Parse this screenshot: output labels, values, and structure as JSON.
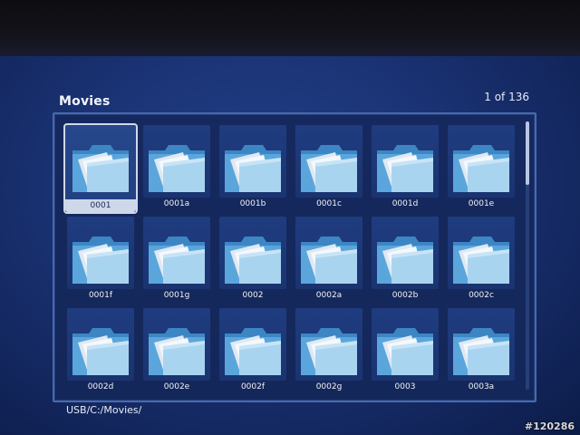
{
  "header": {
    "title": "Movies",
    "page_counter": "1 of 136"
  },
  "path": "USB/C:/Movies/",
  "watermark": "#120286",
  "items": [
    {
      "label": "0001",
      "selected": true
    },
    {
      "label": "0001a"
    },
    {
      "label": "0001b"
    },
    {
      "label": "0001c"
    },
    {
      "label": "0001d"
    },
    {
      "label": "0001e"
    },
    {
      "label": "0001f"
    },
    {
      "label": "0001g"
    },
    {
      "label": "0002"
    },
    {
      "label": "0002a"
    },
    {
      "label": "0002b"
    },
    {
      "label": "0002c"
    },
    {
      "label": "0002d"
    },
    {
      "label": "0002e"
    },
    {
      "label": "0002f"
    },
    {
      "label": "0002g"
    },
    {
      "label": "0003"
    },
    {
      "label": "0003a"
    }
  ],
  "icons": {
    "item": "folder-icon"
  },
  "colors": {
    "background": "#1b3476",
    "panel_border": "#4a6aa8",
    "selection": "#cfd8ea"
  }
}
